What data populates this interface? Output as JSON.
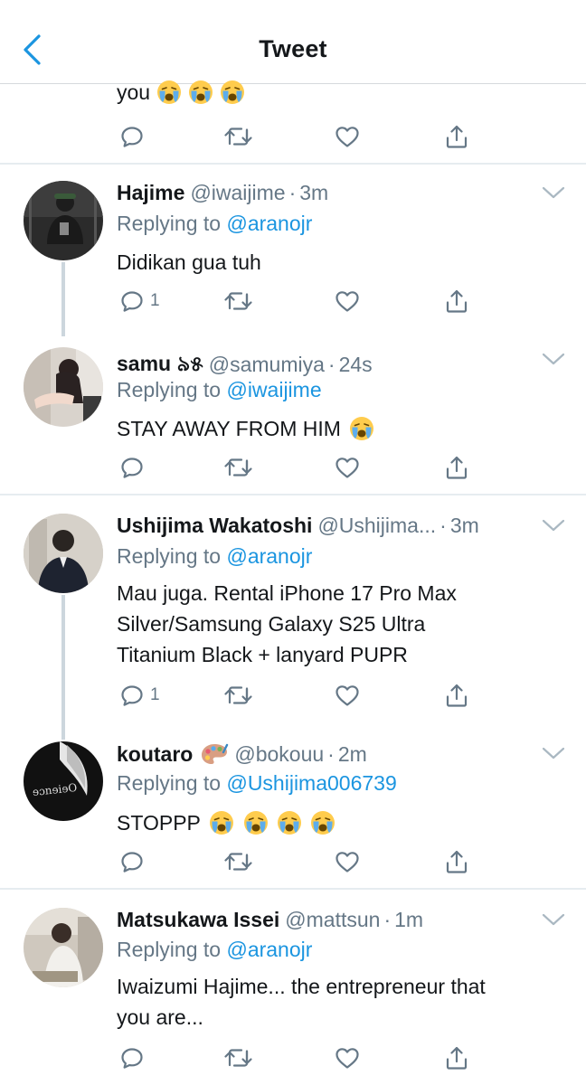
{
  "header": {
    "title": "Tweet"
  },
  "top_cut": {
    "text": "you"
  },
  "tweets": [
    {
      "name": "Hajime",
      "handle": "@iwaijime",
      "time": "3m",
      "replying_prefix": "Replying to ",
      "replying_to": "@aranojr",
      "text": "Didikan gua tuh",
      "reply_count": "1"
    },
    {
      "name": "samu ৯୫",
      "handle": "@samumiya",
      "time": "24s",
      "replying_prefix": "Replying to ",
      "replying_to": "@iwaijime",
      "text": "STAY AWAY FROM HIM",
      "reply_count": ""
    },
    {
      "name": "Ushijima Wakatoshi",
      "handle": "@Ushijima...",
      "time": "3m",
      "replying_prefix": "Replying to ",
      "replying_to": "@aranojr",
      "text_lines": [
        "Mau juga. Rental iPhone 17 Pro Max",
        "Silver/Samsung Galaxy S25 Ultra",
        "Titanium Black + lanyard PUPR"
      ],
      "reply_count": "1"
    },
    {
      "name": "koutaro",
      "handle": "@bokouu",
      "time": "2m",
      "replying_prefix": "Replying to ",
      "replying_to": "@Ushijima006739",
      "text": "STOPPP",
      "reply_count": ""
    },
    {
      "name": "Matsukawa Issei",
      "handle": "@mattsun",
      "time": "1m",
      "replying_prefix": "Replying to ",
      "replying_to": "@aranojr",
      "text_lines": [
        "Iwaizumi Hajime... the entrepreneur that",
        "you are..."
      ],
      "reply_count": ""
    }
  ],
  "colors": {
    "accent": "#1b95e0",
    "secondary": "#657786",
    "icon": "#657786",
    "divider": "#e6ecf0",
    "thread": "#ccd6dd"
  },
  "icons": [
    "back-chevron-icon",
    "reply-icon",
    "retweet-icon",
    "like-icon",
    "share-icon",
    "caret-down-icon",
    "crying-face-emoji",
    "artist-palette-emoji"
  ]
}
